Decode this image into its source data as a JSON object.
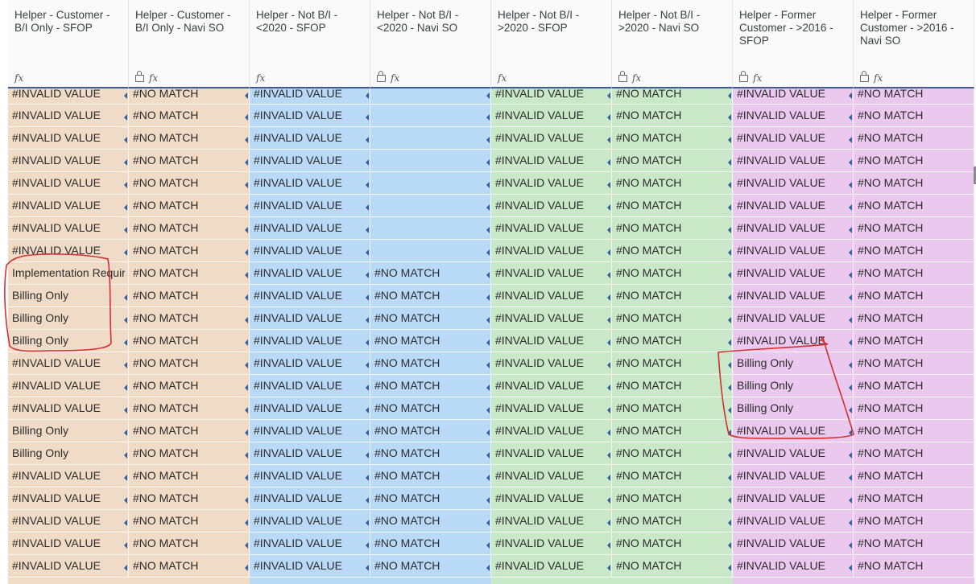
{
  "colors": {
    "beige": "#f0dcc6",
    "blue": "#b9daf7",
    "green": "#c9e8c8",
    "pink": "#ebc9ef",
    "annotation": "#d32f2f"
  },
  "columns": [
    {
      "title": "Helper - Customer - B/I Only - SFOP",
      "color": "beige",
      "lock": false,
      "fx": true
    },
    {
      "title": "Helper - Customer - B/I Only - Navi SO",
      "color": "beige",
      "lock": true,
      "fx": true
    },
    {
      "title": "Helper - Not B/I - <2020 - SFOP",
      "color": "blue",
      "lock": false,
      "fx": true
    },
    {
      "title": "Helper - Not B/I - <2020 - Navi SO",
      "color": "blue",
      "lock": true,
      "fx": true
    },
    {
      "title": "Helper - Not B/I - >2020 - SFOP",
      "color": "green",
      "lock": false,
      "fx": true
    },
    {
      "title": "Helper - Not B/I - >2020 - Navi SO",
      "color": "green",
      "lock": true,
      "fx": true
    },
    {
      "title": "Helper - Former Customer - >2016 - SFOP",
      "color": "pink",
      "lock": true,
      "fx": true
    },
    {
      "title": "Helper - Former Customer - >2016 - Navi SO",
      "color": "pink",
      "lock": true,
      "fx": true
    }
  ],
  "rows": [
    [
      "#INVALID VALUE",
      "#NO MATCH",
      "#INVALID VALUE",
      "",
      "#INVALID VALUE",
      "#NO MATCH",
      "#INVALID VALUE",
      "#NO MATCH"
    ],
    [
      "#INVALID VALUE",
      "#NO MATCH",
      "#INVALID VALUE",
      "",
      "#INVALID VALUE",
      "#NO MATCH",
      "#INVALID VALUE",
      "#NO MATCH"
    ],
    [
      "#INVALID VALUE",
      "#NO MATCH",
      "#INVALID VALUE",
      "",
      "#INVALID VALUE",
      "#NO MATCH",
      "#INVALID VALUE",
      "#NO MATCH"
    ],
    [
      "#INVALID VALUE",
      "#NO MATCH",
      "#INVALID VALUE",
      "",
      "#INVALID VALUE",
      "#NO MATCH",
      "#INVALID VALUE",
      "#NO MATCH"
    ],
    [
      "#INVALID VALUE",
      "#NO MATCH",
      "#INVALID VALUE",
      "",
      "#INVALID VALUE",
      "#NO MATCH",
      "#INVALID VALUE",
      "#NO MATCH"
    ],
    [
      "#INVALID VALUE",
      "#NO MATCH",
      "#INVALID VALUE",
      "",
      "#INVALID VALUE",
      "#NO MATCH",
      "#INVALID VALUE",
      "#NO MATCH"
    ],
    [
      "#INVALID VALUE",
      "#NO MATCH",
      "#INVALID VALUE",
      "",
      "#INVALID VALUE",
      "#NO MATCH",
      "#INVALID VALUE",
      "#NO MATCH"
    ],
    [
      "#INVALID VALUE",
      "#NO MATCH",
      "#INVALID VALUE",
      "",
      "#INVALID VALUE",
      "#NO MATCH",
      "#INVALID VALUE",
      "#NO MATCH"
    ],
    [
      "Implementation Required",
      "#NO MATCH",
      "#INVALID VALUE",
      "#NO MATCH",
      "#INVALID VALUE",
      "#NO MATCH",
      "#INVALID VALUE",
      "#NO MATCH"
    ],
    [
      "Billing Only",
      "#NO MATCH",
      "#INVALID VALUE",
      "#NO MATCH",
      "#INVALID VALUE",
      "#NO MATCH",
      "#INVALID VALUE",
      "#NO MATCH"
    ],
    [
      "Billing Only",
      "#NO MATCH",
      "#INVALID VALUE",
      "#NO MATCH",
      "#INVALID VALUE",
      "#NO MATCH",
      "#INVALID VALUE",
      "#NO MATCH"
    ],
    [
      "Billing Only",
      "#NO MATCH",
      "#INVALID VALUE",
      "#NO MATCH",
      "#INVALID VALUE",
      "#NO MATCH",
      "#INVALID VALUE",
      "#NO MATCH"
    ],
    [
      "#INVALID VALUE",
      "#NO MATCH",
      "#INVALID VALUE",
      "#NO MATCH",
      "#INVALID VALUE",
      "#NO MATCH",
      "Billing Only",
      "#NO MATCH"
    ],
    [
      "#INVALID VALUE",
      "#NO MATCH",
      "#INVALID VALUE",
      "#NO MATCH",
      "#INVALID VALUE",
      "#NO MATCH",
      "Billing Only",
      "#NO MATCH"
    ],
    [
      "#INVALID VALUE",
      "#NO MATCH",
      "#INVALID VALUE",
      "#NO MATCH",
      "#INVALID VALUE",
      "#NO MATCH",
      "Billing Only",
      "#NO MATCH"
    ],
    [
      "Billing Only",
      "#NO MATCH",
      "#INVALID VALUE",
      "#NO MATCH",
      "#INVALID VALUE",
      "#NO MATCH",
      "#INVALID VALUE",
      "#NO MATCH"
    ],
    [
      "Billing Only",
      "#NO MATCH",
      "#INVALID VALUE",
      "#NO MATCH",
      "#INVALID VALUE",
      "#NO MATCH",
      "#INVALID VALUE",
      "#NO MATCH"
    ],
    [
      "#INVALID VALUE",
      "#NO MATCH",
      "#INVALID VALUE",
      "#NO MATCH",
      "#INVALID VALUE",
      "#NO MATCH",
      "#INVALID VALUE",
      "#NO MATCH"
    ],
    [
      "#INVALID VALUE",
      "#NO MATCH",
      "#INVALID VALUE",
      "#NO MATCH",
      "#INVALID VALUE",
      "#NO MATCH",
      "#INVALID VALUE",
      "#NO MATCH"
    ],
    [
      "#INVALID VALUE",
      "#NO MATCH",
      "#INVALID VALUE",
      "#NO MATCH",
      "#INVALID VALUE",
      "#NO MATCH",
      "#INVALID VALUE",
      "#NO MATCH"
    ],
    [
      "#INVALID VALUE",
      "#NO MATCH",
      "#INVALID VALUE",
      "#NO MATCH",
      "#INVALID VALUE",
      "#NO MATCH",
      "#INVALID VALUE",
      "#NO MATCH"
    ],
    [
      "#INVALID VALUE",
      "#NO MATCH",
      "#INVALID VALUE",
      "#NO MATCH",
      "#INVALID VALUE",
      "#NO MATCH",
      "#INVALID VALUE",
      "#NO MATCH"
    ]
  ],
  "cell_indicator_rows": [
    0,
    1,
    2,
    3,
    4,
    5,
    6,
    7,
    9,
    10,
    11,
    12,
    13,
    14,
    15,
    16,
    17,
    18,
    19,
    20,
    21
  ]
}
